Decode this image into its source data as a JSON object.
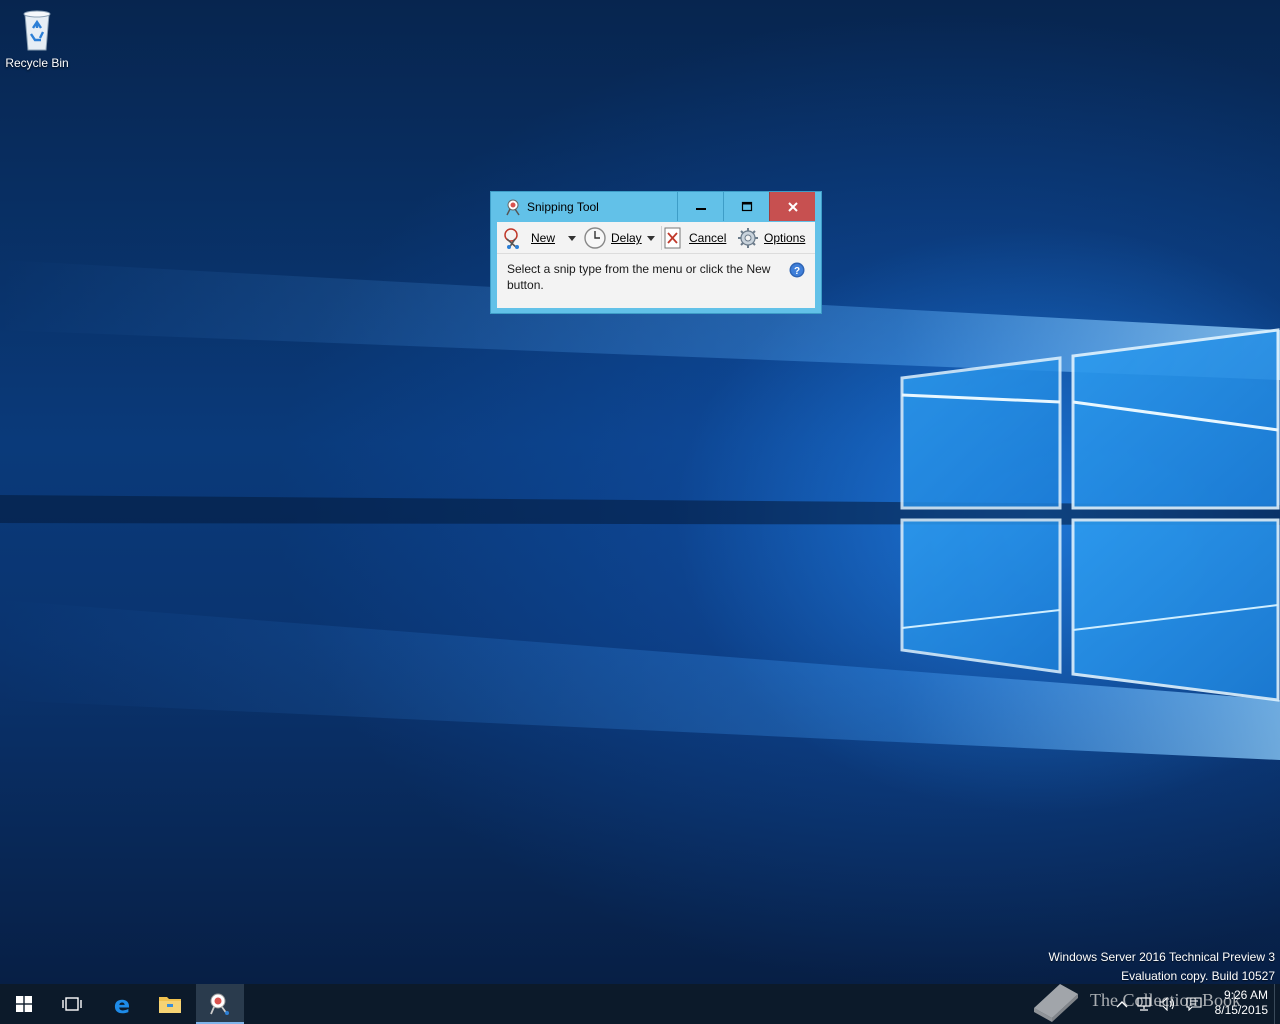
{
  "desktop": {
    "icons": [
      {
        "label": "Recycle Bin",
        "icon": "recycle-bin-icon"
      }
    ],
    "watermark": {
      "line1": "Windows Server 2016 Technical Preview 3",
      "line2": "Evaluation copy. Build 10527"
    },
    "brand": "The Collection Book"
  },
  "window": {
    "title": "Snipping Tool",
    "controls": {
      "minimize": "minimize-icon",
      "maximize": "maximize-icon",
      "close": "close-icon"
    },
    "toolbar": {
      "new_label": "New",
      "delay_label": "Delay",
      "cancel_label": "Cancel",
      "options_label": "Options"
    },
    "message": "Select a snip type from the menu or click the New button.",
    "colors": {
      "frame": "#62c1e8",
      "close": "#c75050"
    }
  },
  "taskbar": {
    "items": [
      "start-icon",
      "task-view-icon",
      "edge-icon",
      "file-explorer-icon",
      "snipping-tool-icon"
    ],
    "tray": [
      "show-hidden-icons-icon",
      "network-icon",
      "volume-icon",
      "action-center-icon"
    ],
    "time": "9:26 AM",
    "date": "8/15/2015"
  }
}
